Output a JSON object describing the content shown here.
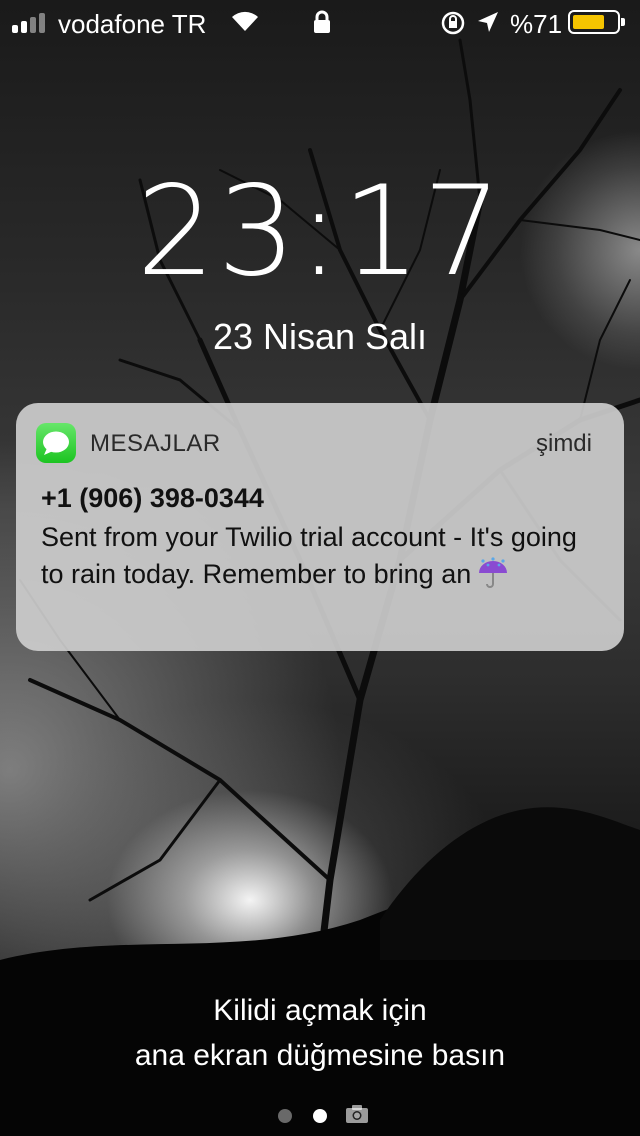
{
  "status_bar": {
    "carrier": "vodafone TR",
    "battery_percent_label": "%71",
    "battery_level": 0.71,
    "battery_color": "#f5c400",
    "icons": [
      "signal-icon",
      "wifi-icon",
      "lock-icon",
      "rotation-lock-icon",
      "location-arrow-icon",
      "battery-icon"
    ]
  },
  "lock_screen": {
    "time": "23:17",
    "date": "23 Nisan Salı"
  },
  "notification": {
    "app_name": "MESAJLAR",
    "app_icon": "messages-icon",
    "time": "şimdi",
    "sender": "+1 (906) 398-0344",
    "body": "Sent from your Twilio trial account - It's going to rain today. Remember to bring an",
    "body_emoji": "umbrella-with-rain-icon"
  },
  "unlock_hint": {
    "line1": "Kilidi açmak için",
    "line2": "ana ekran düğmesine basın"
  },
  "page_indicator": {
    "pages": 2,
    "active_page": 2,
    "trailing_icon": "camera-icon"
  }
}
